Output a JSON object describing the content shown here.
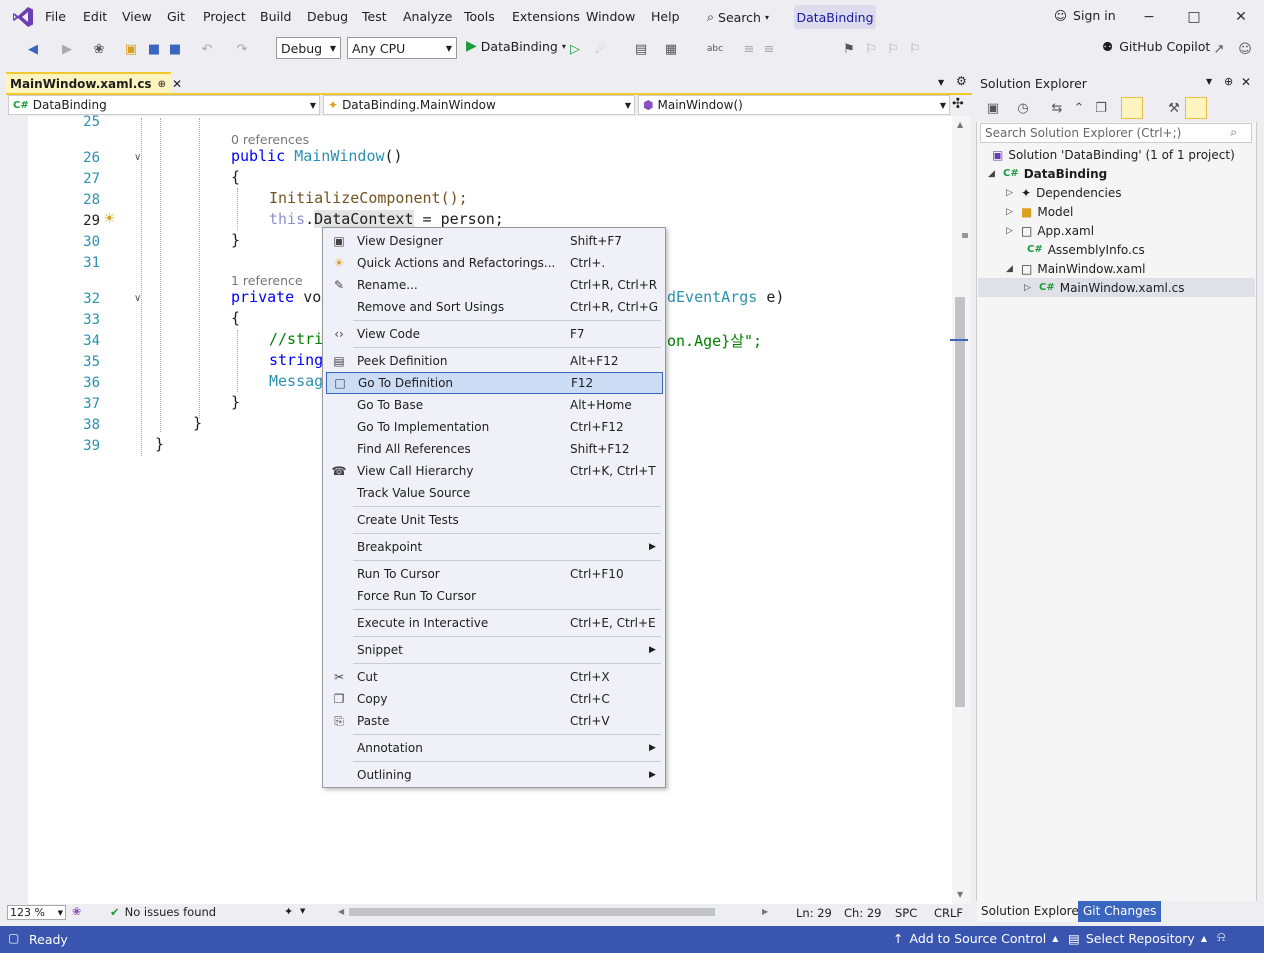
{
  "menubar": {
    "items": [
      "File",
      "Edit",
      "View",
      "Git",
      "Project",
      "Build",
      "Debug",
      "Test",
      "Analyze",
      "Tools",
      "Extensions",
      "Window",
      "Help"
    ],
    "search_label": "Search",
    "solution_name": "DataBinding",
    "sign_in": "Sign in"
  },
  "toolbar": {
    "config": "Debug",
    "platform": "Any CPU",
    "run_target": "DataBinding",
    "copilot": "GitHub Copilot"
  },
  "editor": {
    "tab_label": "MainWindow.xaml.cs",
    "nav_project": "DataBinding",
    "nav_class": "DataBinding.MainWindow",
    "nav_member": "MainWindow()",
    "lines": [
      "25",
      "26",
      "27",
      "28",
      "29",
      "30",
      "31",
      "32",
      "33",
      "34",
      "35",
      "36",
      "37",
      "38",
      "39"
    ],
    "refs_0": "0 references",
    "refs_1": "1 reference",
    "code": {
      "l26_kw": "public",
      "l26_name": "MainWindow",
      "l26_rest": "()",
      "l27": "{",
      "l28": "InitializeComponent();",
      "l29_this": "this",
      "l29_dot": ".",
      "l29_prop": "DataContext",
      "l29_rest": " = person;",
      "l30": "}",
      "l32_kw": "private",
      "l32_partial": " vo",
      "l32_tail": "dEventArgs",
      "l32_end": " e)",
      "l33": "{",
      "l34_start": "//stri",
      "l34_tail": "on.Age}살\";",
      "l35_kw": "string",
      "l36": "Messag",
      "l37": "}",
      "l38": "}",
      "l39": "}"
    }
  },
  "context_menu": {
    "items": [
      {
        "label": "View Designer",
        "shortcut": "Shift+F7",
        "icon": "view-designer-icon"
      },
      {
        "label": "Quick Actions and Refactorings...",
        "shortcut": "Ctrl+.",
        "icon": "lightbulb-icon"
      },
      {
        "label": "Rename...",
        "shortcut": "Ctrl+R, Ctrl+R",
        "icon": "rename-icon"
      },
      {
        "label": "Remove and Sort Usings",
        "shortcut": "Ctrl+R, Ctrl+G",
        "icon": ""
      },
      {
        "label": "View Code",
        "shortcut": "F7",
        "icon": "view-code-icon"
      },
      {
        "label": "Peek Definition",
        "shortcut": "Alt+F12",
        "icon": "peek-definition-icon"
      },
      {
        "label": "Go To Definition",
        "shortcut": "F12",
        "icon": "go-to-definition-icon"
      },
      {
        "label": "Go To Base",
        "shortcut": "Alt+Home",
        "icon": ""
      },
      {
        "label": "Go To Implementation",
        "shortcut": "Ctrl+F12",
        "icon": ""
      },
      {
        "label": "Find All References",
        "shortcut": "Shift+F12",
        "icon": ""
      },
      {
        "label": "View Call Hierarchy",
        "shortcut": "Ctrl+K, Ctrl+T",
        "icon": "call-hierarchy-icon"
      },
      {
        "label": "Track Value Source",
        "shortcut": "",
        "icon": ""
      },
      {
        "label": "Create Unit Tests",
        "shortcut": "",
        "icon": ""
      },
      {
        "label": "Breakpoint",
        "shortcut": "",
        "icon": ""
      },
      {
        "label": "Run To Cursor",
        "shortcut": "Ctrl+F10",
        "icon": ""
      },
      {
        "label": "Force Run To Cursor",
        "shortcut": "",
        "icon": ""
      },
      {
        "label": "Execute in Interactive",
        "shortcut": "Ctrl+E, Ctrl+E",
        "icon": ""
      },
      {
        "label": "Snippet",
        "shortcut": "",
        "icon": ""
      },
      {
        "label": "Cut",
        "shortcut": "Ctrl+X",
        "icon": "cut-icon"
      },
      {
        "label": "Copy",
        "shortcut": "Ctrl+C",
        "icon": "copy-icon"
      },
      {
        "label": "Paste",
        "shortcut": "Ctrl+V",
        "icon": "paste-icon"
      },
      {
        "label": "Annotation",
        "shortcut": "",
        "icon": ""
      },
      {
        "label": "Outlining",
        "shortcut": "",
        "icon": ""
      }
    ]
  },
  "solution_explorer": {
    "title": "Solution Explorer",
    "search_placeholder": "Search Solution Explorer (Ctrl+;)",
    "solution": "Solution 'DataBinding' (1 of 1 project)",
    "project": "DataBinding",
    "dependencies": "Dependencies",
    "model": "Model",
    "app_xaml": "App.xaml",
    "assembly_info": "AssemblyInfo.cs",
    "main_window_xaml": "MainWindow.xaml",
    "main_window_cs": "MainWindow.xaml.cs",
    "tab_se": "Solution Explorer",
    "tab_git": "Git Changes"
  },
  "editor_status": {
    "zoom": "123 %",
    "issues": "No issues found",
    "line": "Ln: 29",
    "col": "Ch: 29",
    "spc": "SPC",
    "eol": "CRLF"
  },
  "statusbar": {
    "ready": "Ready",
    "source_control": "Add to Source Control",
    "repository": "Select Repository"
  },
  "colors": {
    "accent": "#3a55b0",
    "tab_active": "#fdf4bf",
    "menu_selected": "#cddcf5",
    "keyword": "#0000ff",
    "type": "#2b91af",
    "method": "#74531f",
    "comment": "#008000"
  }
}
